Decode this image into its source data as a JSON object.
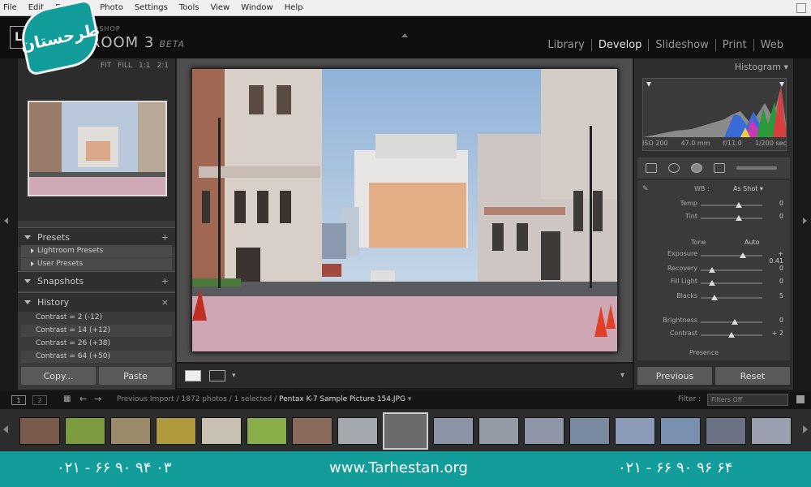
{
  "menu": [
    "File",
    "Edit",
    "Develop",
    "Photo",
    "Settings",
    "Tools",
    "View",
    "Window",
    "Help"
  ],
  "app": {
    "logo": "Lr",
    "product_line": "ADOBE PHOTOSHOP",
    "product_name": "LIGHTROOM 3",
    "beta": "BETA",
    "watermark": "طرحستان"
  },
  "modules": [
    "Library",
    "Develop",
    "Slideshow",
    "Print",
    "Web"
  ],
  "active_module": "Develop",
  "navigator": {
    "zoom_options": [
      "FIT",
      "FILL",
      "1:1",
      "2:1"
    ]
  },
  "left_panels": {
    "presets": {
      "label": "Presets",
      "action": "+",
      "items": [
        "Lightroom Presets",
        "User Presets"
      ]
    },
    "snapshots": {
      "label": "Snapshots",
      "action": "+"
    },
    "history": {
      "label": "History",
      "action": "×",
      "items": [
        "Contrast = 2 (-12)",
        "Contrast = 14 (+12)",
        "Contrast = 26 (+38)",
        "Contrast = 64 (+50)"
      ]
    },
    "copy_button": "Copy...",
    "paste_button": "Paste"
  },
  "histogram": {
    "label": "Histogram",
    "iso": "ISO 200",
    "focal": "47.0 mm",
    "aperture": "f/11.0",
    "shutter": "1/200 sec"
  },
  "basic": {
    "wb_label": "WB :",
    "wb_value": "As Shot",
    "tone_label": "Tone",
    "tone_auto": "Auto",
    "presence_label": "Presence",
    "sliders": [
      {
        "label": "Temp",
        "value": "0",
        "pos": 0.62
      },
      {
        "label": "Tint",
        "value": "0",
        "pos": 0.62
      },
      {
        "label": "Exposure",
        "value": "+ 0.41",
        "pos": 0.68
      },
      {
        "label": "Recovery",
        "value": "0",
        "pos": 0.18
      },
      {
        "label": "Fill Light",
        "value": "0",
        "pos": 0.18
      },
      {
        "label": "Blacks",
        "value": "5",
        "pos": 0.22
      },
      {
        "label": "Brightness",
        "value": "0",
        "pos": 0.55
      },
      {
        "label": "Contrast",
        "value": "+ 2",
        "pos": 0.5
      }
    ],
    "previous_button": "Previous",
    "reset_button": "Reset"
  },
  "filmstrip": {
    "screen_1": "1",
    "screen_2": "2",
    "source": "Previous Import / 1872 photos / 1 selected /",
    "filename": "Pentax K-7 Sample Picture 154.JPG",
    "filter_label": "Filter :",
    "filter_value": "Filters Off",
    "thumb_colors": [
      "#7a5a4a",
      "#7c9a3e",
      "#9a8a6a",
      "#b09a3c",
      "#c8c0b0",
      "#8aae4a",
      "#8a6a5a",
      "#a6a8b0",
      "#a8a0a0",
      "#8a94a6",
      "#949aa6",
      "#8e96a8",
      "#7a8aa0",
      "#8a9ab8",
      "#7a90b0",
      "#6a7284",
      "#9aa0b0"
    ],
    "selected_index": 8
  },
  "footer": {
    "phone_left": "۰۲۱ - ۶۶ ۹۰ ۹۴ ۰۳",
    "site": "www.Tarhestan.org",
    "phone_right": "۰۲۱ - ۶۶ ۹۰ ۹۶ ۶۴"
  }
}
